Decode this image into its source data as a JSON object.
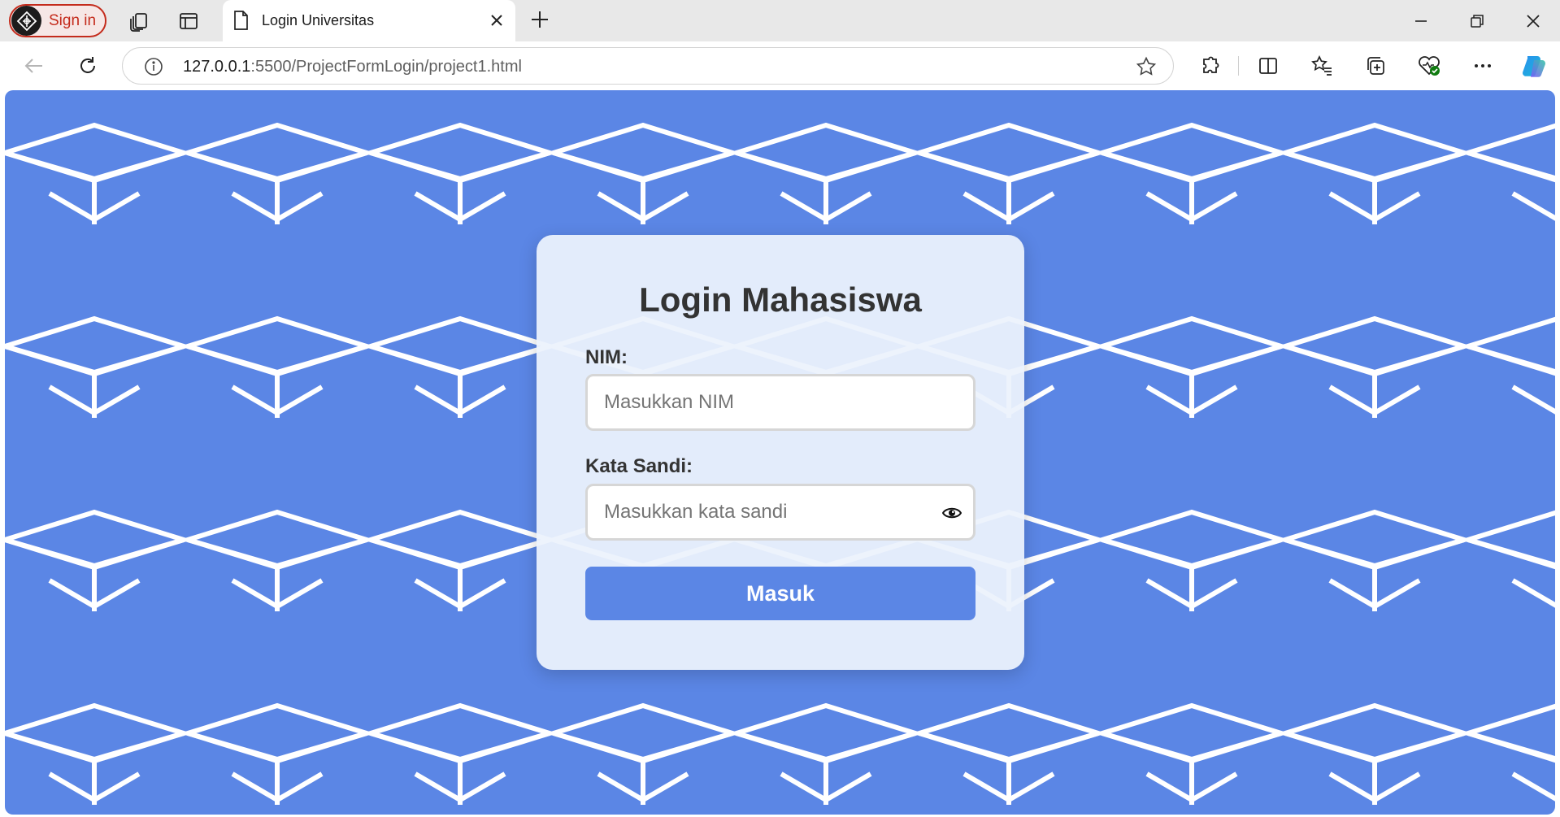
{
  "browser": {
    "profile": {
      "label": "Sign in"
    },
    "tab": {
      "title": "Login Universitas"
    },
    "address": {
      "host": "127.0.0.1",
      "rest": ":5500/ProjectFormLogin/project1.html"
    }
  },
  "page": {
    "background_color": "#5b86e5",
    "pattern_icon": "graduation-cap-icon",
    "card_color": "#edf2fb",
    "title": "Login Mahasiswa",
    "form": {
      "nim_label": "NIM:",
      "nim_placeholder": "Masukkan NIM",
      "password_label": "Kata Sandi:",
      "password_placeholder": "Masukkan kata sandi",
      "password_toggle_icon": "eye-icon",
      "submit_label": "Masuk",
      "accent_color": "#5b86e5"
    }
  }
}
